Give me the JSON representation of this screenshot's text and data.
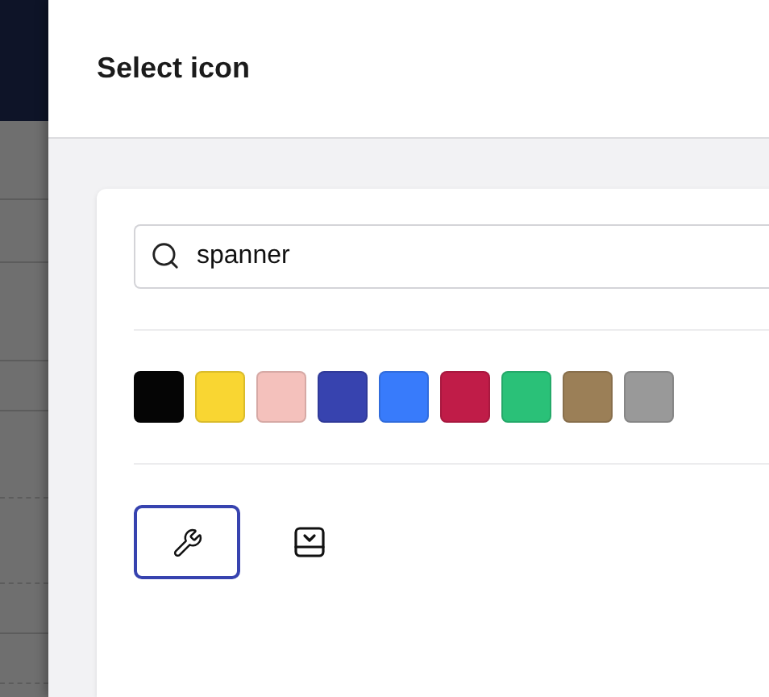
{
  "dialog": {
    "title": "Select icon"
  },
  "search": {
    "value": "spanner"
  },
  "colors": [
    {
      "color": "#050505"
    },
    {
      "color": "#f9d632"
    },
    {
      "color": "#f4c1bc"
    },
    {
      "color": "#3743af"
    },
    {
      "color": "#387bfb"
    },
    {
      "color": "#c01c48"
    },
    {
      "color": "#2ac178"
    },
    {
      "color": "#9b7f57"
    },
    {
      "color": "#999999"
    }
  ],
  "icons": [
    {
      "kind": "wrench",
      "selected": true
    },
    {
      "kind": "chevron-box",
      "selected": false
    }
  ]
}
